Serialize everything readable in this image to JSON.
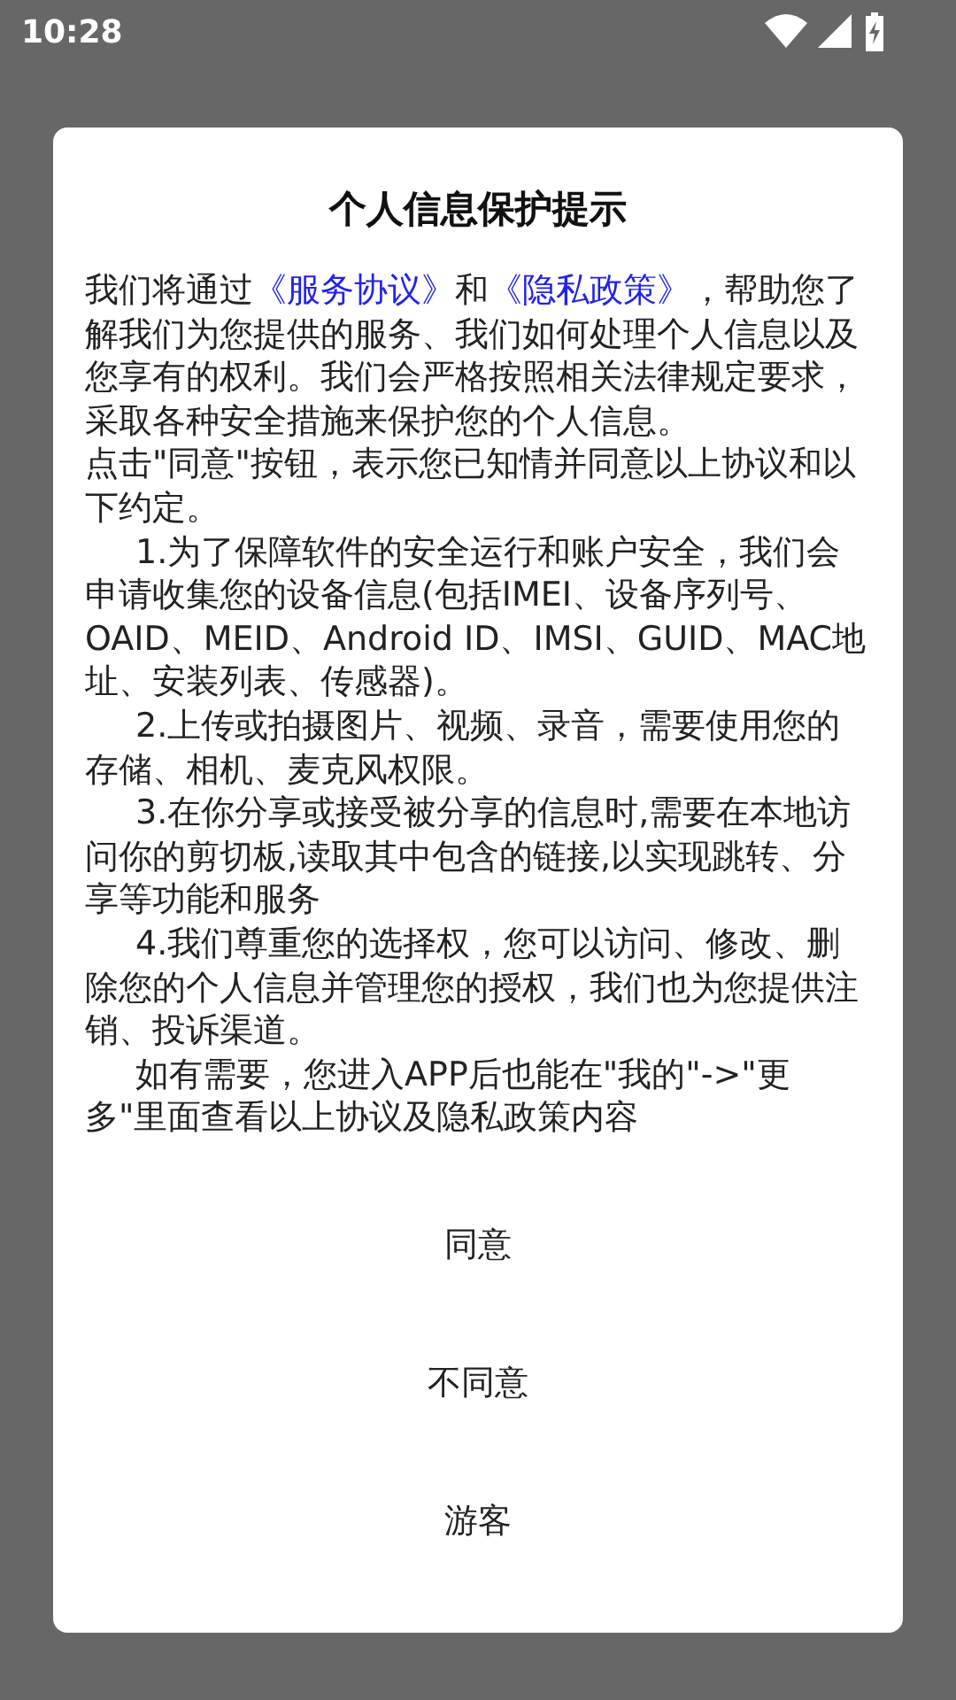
{
  "status_bar": {
    "time": "10:28"
  },
  "dialog": {
    "title": "个人信息保护提示",
    "paragraphs": [
      {
        "kind": "intro",
        "parts": [
          {
            "kind": "text",
            "text": "我们将通过"
          },
          {
            "kind": "link",
            "text": "《服务协议》"
          },
          {
            "kind": "text",
            "text": "和"
          },
          {
            "kind": "link",
            "text": "《隐私政策》"
          },
          {
            "kind": "text",
            "text": "，帮助您了解我们为您提供的服务、我们如何处理个人信息以及您享有的权利。我们会严格按照相关法律规定要求，采取各种安全措施来保护您的个人信息。"
          }
        ]
      },
      {
        "kind": "intro",
        "parts": [
          {
            "kind": "text",
            "text": "点击\"同意\"按钮，表示您已知情并同意以上协议和以下约定。"
          }
        ]
      },
      {
        "kind": "item",
        "parts": [
          {
            "kind": "text",
            "text": "1.为了保障软件的安全运行和账户安全，我们会申请收集您的设备信息(包括IMEI、设备序列号、OAID、MEID、Android ID、IMSI、GUID、MAC地址、安装列表、传感器)。"
          }
        ]
      },
      {
        "kind": "item",
        "parts": [
          {
            "kind": "text",
            "text": "2.上传或拍摄图片、视频、录音，需要使用您的存储、相机、麦克风权限。"
          }
        ]
      },
      {
        "kind": "item",
        "parts": [
          {
            "kind": "text",
            "text": "3.在你分享或接受被分享的信息时,需要在本地访问你的剪切板,读取其中包含的链接,以实现跳转、分享等功能和服务"
          }
        ]
      },
      {
        "kind": "item",
        "parts": [
          {
            "kind": "text",
            "text": "4.我们尊重您的选择权，您可以访问、修改、删除您的个人信息并管理您的授权，我们也为您提供注销、投诉渠道。"
          }
        ]
      },
      {
        "kind": "item",
        "parts": [
          {
            "kind": "text",
            "text": "如有需要，您进入APP后也能在\"我的\"->\"更多\"里面查看以上协议及隐私政策内容"
          }
        ]
      }
    ],
    "buttons": [
      "同意",
      "不同意",
      "游客"
    ]
  }
}
